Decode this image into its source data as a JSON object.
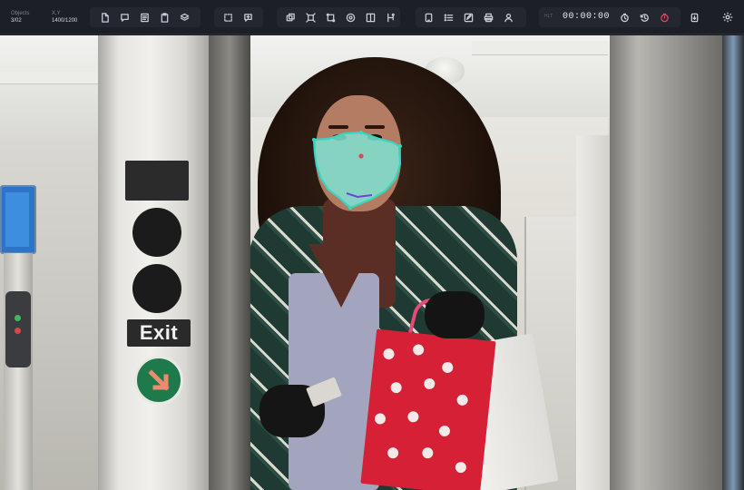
{
  "info": {
    "objects_label": "Objects",
    "objects_value": "3/02",
    "xy_label": "X,Y",
    "xy_value": "1400/1200"
  },
  "toolbar": {
    "group1_icons": [
      "new-file-icon",
      "comment-icon",
      "document-icon",
      "clipboard-icon",
      "layers-icon"
    ],
    "group2_icons": [
      "select-box-icon",
      "comment-add-icon"
    ],
    "group3_icons": [
      "copy-icon",
      "resize-icon",
      "crop-icon",
      "target-icon",
      "split-icon",
      "merge-icon"
    ],
    "group4_icons": [
      "tablet-icon",
      "checklist-icon",
      "edit-box-icon",
      "print-icon",
      "user-icon"
    ],
    "timer_label": "HLT",
    "timer_value": "00:00:00",
    "timer_icons": [
      "clock-icon",
      "history-icon",
      "stop-icon"
    ],
    "export_icon": "export-icon",
    "settings_icon": "gear-icon"
  },
  "scene": {
    "exit_sign": "Exit"
  },
  "colors": {
    "annotation_stroke": "#37d6c1",
    "annotation_fill": "#7fe3d2",
    "annotation_point": "#e0455a",
    "keypoint_line": "#6a44d8",
    "toolbar_bg": "#1c1f26",
    "accent_red": "#e0455a"
  }
}
